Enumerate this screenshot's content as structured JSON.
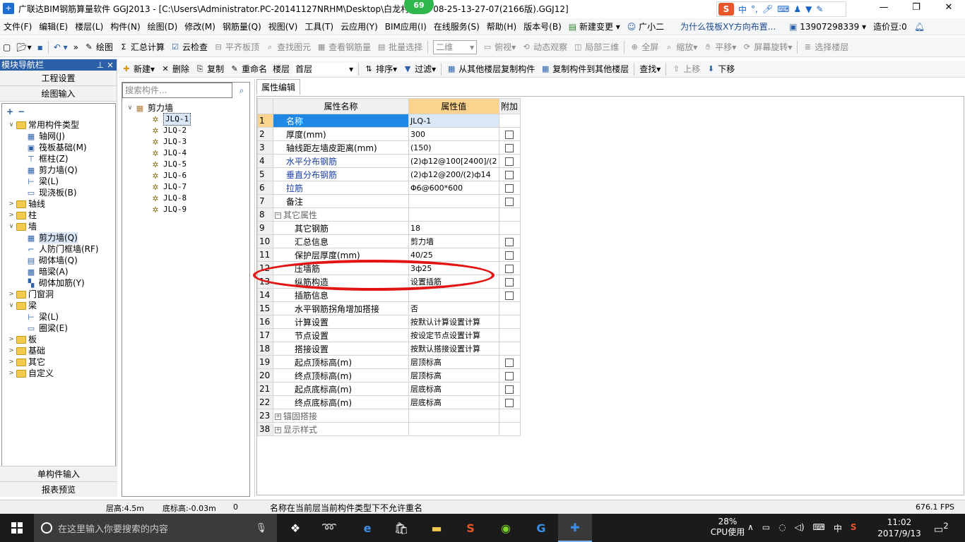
{
  "window": {
    "title": "广联达BIM钢筋算量软件 GGJ2013 - [C:\\Users\\Administrator.PC-20141127NRHM\\Desktop\\白龙村",
    "title_tail": "08-25-13-27-07(2166版).GGJ12]",
    "badge": "69",
    "controls": [
      "—",
      "❐",
      "✕"
    ]
  },
  "ime": {
    "lang": "中",
    "symbols": "°,",
    "icons": [
      "mic-icon",
      "keyboard-icon",
      "user-icon",
      "shirt-icon",
      "wrench-icon"
    ]
  },
  "menu": {
    "items": [
      "文件(F)",
      "编辑(E)",
      "楼层(L)",
      "构件(N)",
      "绘图(D)",
      "修改(M)",
      "钢筋量(Q)",
      "视图(V)",
      "工具(T)",
      "云应用(Y)",
      "BIM应用(I)",
      "在线服务(S)",
      "帮助(H)",
      "版本号(B)"
    ],
    "new_change": "新建变更",
    "guangxiaoer": "广小二",
    "question": "为什么筏板XY方向布置...",
    "phone": "13907298339",
    "coins": "造价豆:0"
  },
  "toolbar1": {
    "draw": "绘图",
    "sum": "汇总计算",
    "cloud_check": "云检查",
    "flush_top": "平齐板顶",
    "find_elem": "查找图元",
    "view_rebar": "查看钢筋量",
    "batch_select": "批量选择",
    "view_mode": "二维",
    "top_view": "俯视",
    "dynamic_view": "动态观察",
    "local_3d": "局部三维",
    "fullscreen": "全屏",
    "zoom": "缩放",
    "pan": "平移",
    "rotate": "屏幕旋转",
    "select_floor": "选择楼层"
  },
  "nav": {
    "header": "模块导航栏",
    "header_pins": "⊥ ×",
    "tab_project": "工程设置",
    "tab_draw": "绘图输入",
    "tab_single": "单构件输入",
    "tab_report": "报表预览",
    "tree": [
      {
        "label": "常用构件类型",
        "level": 0,
        "expand": "∨",
        "type": "folder"
      },
      {
        "label": "轴网(J)",
        "level": 1,
        "type": "grid"
      },
      {
        "label": "筏板基础(M)",
        "level": 1,
        "type": "raft"
      },
      {
        "label": "框柱(Z)",
        "level": 1,
        "type": "column"
      },
      {
        "label": "剪力墙(Q)",
        "level": 1,
        "type": "wall"
      },
      {
        "label": "梁(L)",
        "level": 1,
        "type": "beam"
      },
      {
        "label": "现浇板(B)",
        "level": 1,
        "type": "slab"
      },
      {
        "label": "轴线",
        "level": 0,
        "expand": ">",
        "type": "folder"
      },
      {
        "label": "柱",
        "level": 0,
        "expand": ">",
        "type": "folder"
      },
      {
        "label": "墙",
        "level": 0,
        "expand": "∨",
        "type": "folder"
      },
      {
        "label": "剪力墙(Q)",
        "level": 1,
        "type": "wall",
        "selected": true
      },
      {
        "label": "人防门框墙(RF)",
        "level": 1,
        "type": "door-wall"
      },
      {
        "label": "砌体墙(Q)",
        "level": 1,
        "type": "masonry"
      },
      {
        "label": "暗梁(A)",
        "level": 1,
        "type": "hidden-beam"
      },
      {
        "label": "砌体加筋(Y)",
        "level": 1,
        "type": "masonry-rebar"
      },
      {
        "label": "门窗洞",
        "level": 0,
        "expand": ">",
        "type": "folder"
      },
      {
        "label": "梁",
        "level": 0,
        "expand": "∨",
        "type": "folder"
      },
      {
        "label": "梁(L)",
        "level": 1,
        "type": "beam"
      },
      {
        "label": "圈梁(E)",
        "level": 1,
        "type": "ring-beam"
      },
      {
        "label": "板",
        "level": 0,
        "expand": ">",
        "type": "folder"
      },
      {
        "label": "基础",
        "level": 0,
        "expand": ">",
        "type": "folder"
      },
      {
        "label": "其它",
        "level": 0,
        "expand": ">",
        "type": "folder"
      },
      {
        "label": "自定义",
        "level": 0,
        "expand": ">",
        "type": "folder"
      }
    ]
  },
  "toolbar2": {
    "new": "新建",
    "delete": "删除",
    "copy": "复制",
    "rename": "重命名",
    "floor_label": "楼层",
    "floor_value": "首层",
    "sort": "排序",
    "filter": "过滤",
    "copy_from": "从其他楼层复制构件",
    "copy_to": "复制构件到其他楼层",
    "find": "查找",
    "move_up": "上移",
    "move_down": "下移"
  },
  "components": {
    "search_placeholder": "搜索构件...",
    "root": "剪力墙",
    "items": [
      "JLQ-1",
      "JLQ-2",
      "JLQ-3",
      "JLQ-4",
      "JLQ-5",
      "JLQ-6",
      "JLQ-7",
      "JLQ-8",
      "JLQ-9"
    ]
  },
  "properties": {
    "tab": "属性编辑",
    "headers": [
      "属性名称",
      "属性值",
      "附加"
    ],
    "rows": [
      {
        "num": "1",
        "name": "名称",
        "value": "JLQ-1",
        "check": false,
        "style": "sel",
        "indent": 1
      },
      {
        "num": "2",
        "name": "厚度(mm)",
        "value": "300",
        "check": true,
        "indent": 1
      },
      {
        "num": "3",
        "name": "轴线距左墙皮距离(mm)",
        "value": "(150)",
        "check": true,
        "indent": 1
      },
      {
        "num": "4",
        "name": "水平分布钢筋",
        "value": "(2)ф12@100[2400]/(2",
        "check": true,
        "style": "blue",
        "indent": 1
      },
      {
        "num": "5",
        "name": "垂直分布钢筋",
        "value": "(2)ф12@200/(2)ф14",
        "check": true,
        "style": "blue",
        "indent": 1
      },
      {
        "num": "6",
        "name": "拉筋",
        "value": "Φ6@600*600",
        "check": true,
        "style": "blue",
        "indent": 1
      },
      {
        "num": "7",
        "name": "备注",
        "value": "",
        "check": true,
        "indent": 1
      },
      {
        "num": "8",
        "name": "其它属性",
        "value": "",
        "check": null,
        "style": "group",
        "group": "−"
      },
      {
        "num": "9",
        "name": "其它钢筋",
        "value": "18",
        "check": null,
        "indent": 2
      },
      {
        "num": "10",
        "name": "汇总信息",
        "value": "剪力墙",
        "check": true,
        "indent": 2
      },
      {
        "num": "11",
        "name": "保护层厚度(mm)",
        "value": "40/25",
        "check": true,
        "indent": 2
      },
      {
        "num": "12",
        "name": "压墙筋",
        "value": "3ф25",
        "check": true,
        "indent": 2
      },
      {
        "num": "13",
        "name": "纵筋构造",
        "value": "设置插筋",
        "check": true,
        "indent": 2
      },
      {
        "num": "14",
        "name": "插筋信息",
        "value": "",
        "check": true,
        "indent": 2
      },
      {
        "num": "15",
        "name": "水平钢筋拐角增加搭接",
        "value": "否",
        "check": null,
        "indent": 2
      },
      {
        "num": "16",
        "name": "计算设置",
        "value": "按默认计算设置计算",
        "check": null,
        "indent": 2
      },
      {
        "num": "17",
        "name": "节点设置",
        "value": "按设定节点设置计算",
        "check": null,
        "indent": 2
      },
      {
        "num": "18",
        "name": "搭接设置",
        "value": "按默认搭接设置计算",
        "check": null,
        "indent": 2
      },
      {
        "num": "19",
        "name": "起点顶标高(m)",
        "value": "层顶标高",
        "check": true,
        "indent": 2
      },
      {
        "num": "20",
        "name": "终点顶标高(m)",
        "value": "层顶标高",
        "check": true,
        "indent": 2
      },
      {
        "num": "21",
        "name": "起点底标高(m)",
        "value": "层底标高",
        "check": true,
        "indent": 2
      },
      {
        "num": "22",
        "name": "终点底标高(m)",
        "value": "层底标高",
        "check": true,
        "indent": 2
      },
      {
        "num": "23",
        "name": "锚固搭接",
        "value": "",
        "check": null,
        "style": "group",
        "group": "+"
      },
      {
        "num": "38",
        "name": "显示样式",
        "value": "",
        "check": null,
        "style": "group",
        "group": "+"
      }
    ]
  },
  "status": {
    "floor_height": "层高:4.5m",
    "base_elev": "底标高:-0.03m",
    "zero": "0",
    "message": "名称在当前层当前构件类型下不允许重名",
    "fps": "676.1 FPS"
  },
  "taskbar": {
    "search_placeholder": "在这里输入你要搜索的内容",
    "cpu_pct": "28%",
    "cpu_label": "CPU使用",
    "lang": "中",
    "time": "11:02",
    "date": "2017/9/13",
    "notifications": "2"
  }
}
